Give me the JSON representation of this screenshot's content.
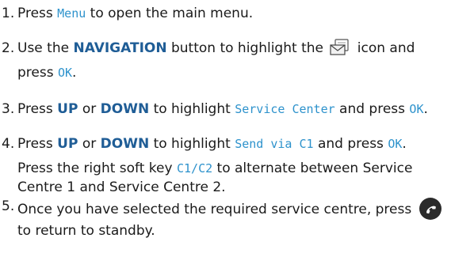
{
  "steps": [
    {
      "number": "1.",
      "lines": [
        {
          "parts": [
            {
              "text": "Press ",
              "style": "plain"
            },
            {
              "text": "Menu",
              "style": "screen"
            },
            {
              "text": " to open the main menu.",
              "style": "plain"
            }
          ]
        }
      ]
    },
    {
      "number": "2.",
      "lines": [
        {
          "parts": [
            {
              "text": "Use the ",
              "style": "plain"
            },
            {
              "text": "NAVIGATION",
              "style": "key"
            },
            {
              "text": " button to highlight the ",
              "style": "plain"
            },
            {
              "icon": "messages-envelope-icon"
            },
            {
              "text": " icon and",
              "style": "plain"
            }
          ]
        },
        {
          "parts": [
            {
              "text": "press ",
              "style": "plain"
            },
            {
              "text": "OK",
              "style": "screen"
            },
            {
              "text": ".",
              "style": "plain"
            }
          ]
        }
      ]
    },
    {
      "number": "3.",
      "lines": [
        {
          "parts": [
            {
              "text": "Press ",
              "style": "plain"
            },
            {
              "text": "UP",
              "style": "key"
            },
            {
              "text": " or ",
              "style": "plain"
            },
            {
              "text": "DOWN",
              "style": "key"
            },
            {
              "text": " to highlight ",
              "style": "plain"
            },
            {
              "text": "Service Center",
              "style": "screen"
            },
            {
              "text": " and press ",
              "style": "plain"
            },
            {
              "text": "OK",
              "style": "screen"
            },
            {
              "text": ".",
              "style": "plain"
            }
          ]
        }
      ]
    },
    {
      "number": "4.",
      "lines": [
        {
          "parts": [
            {
              "text": "Press ",
              "style": "plain"
            },
            {
              "text": "UP",
              "style": "key"
            },
            {
              "text": " or ",
              "style": "plain"
            },
            {
              "text": "DOWN",
              "style": "key"
            },
            {
              "text": " to highlight ",
              "style": "plain"
            },
            {
              "text": "Send via C1",
              "style": "screen"
            },
            {
              "text": " and press ",
              "style": "plain"
            },
            {
              "text": "OK",
              "style": "screen"
            },
            {
              "text": ".",
              "style": "plain"
            }
          ]
        },
        {
          "parts": [
            {
              "text": "Press the right soft key ",
              "style": "plain"
            },
            {
              "text": "C1/C2",
              "style": "screen"
            },
            {
              "text": " to alternate between Service",
              "style": "plain"
            }
          ]
        },
        {
          "parts": [
            {
              "text": "Centre 1 and Service Centre 2.",
              "style": "plain"
            }
          ]
        }
      ]
    },
    {
      "number": "5.",
      "lines": [
        {
          "parts": [
            {
              "text": "Once you have selected the required service centre, press ",
              "style": "plain"
            },
            {
              "icon": "end-call-key-icon"
            }
          ]
        },
        {
          "parts": [
            {
              "text": "to return to standby.",
              "style": "plain"
            }
          ]
        }
      ]
    }
  ],
  "colors": {
    "screen_text": "#2d92cc",
    "key_text": "#1f5d96",
    "body_text": "#1a1a1a"
  }
}
